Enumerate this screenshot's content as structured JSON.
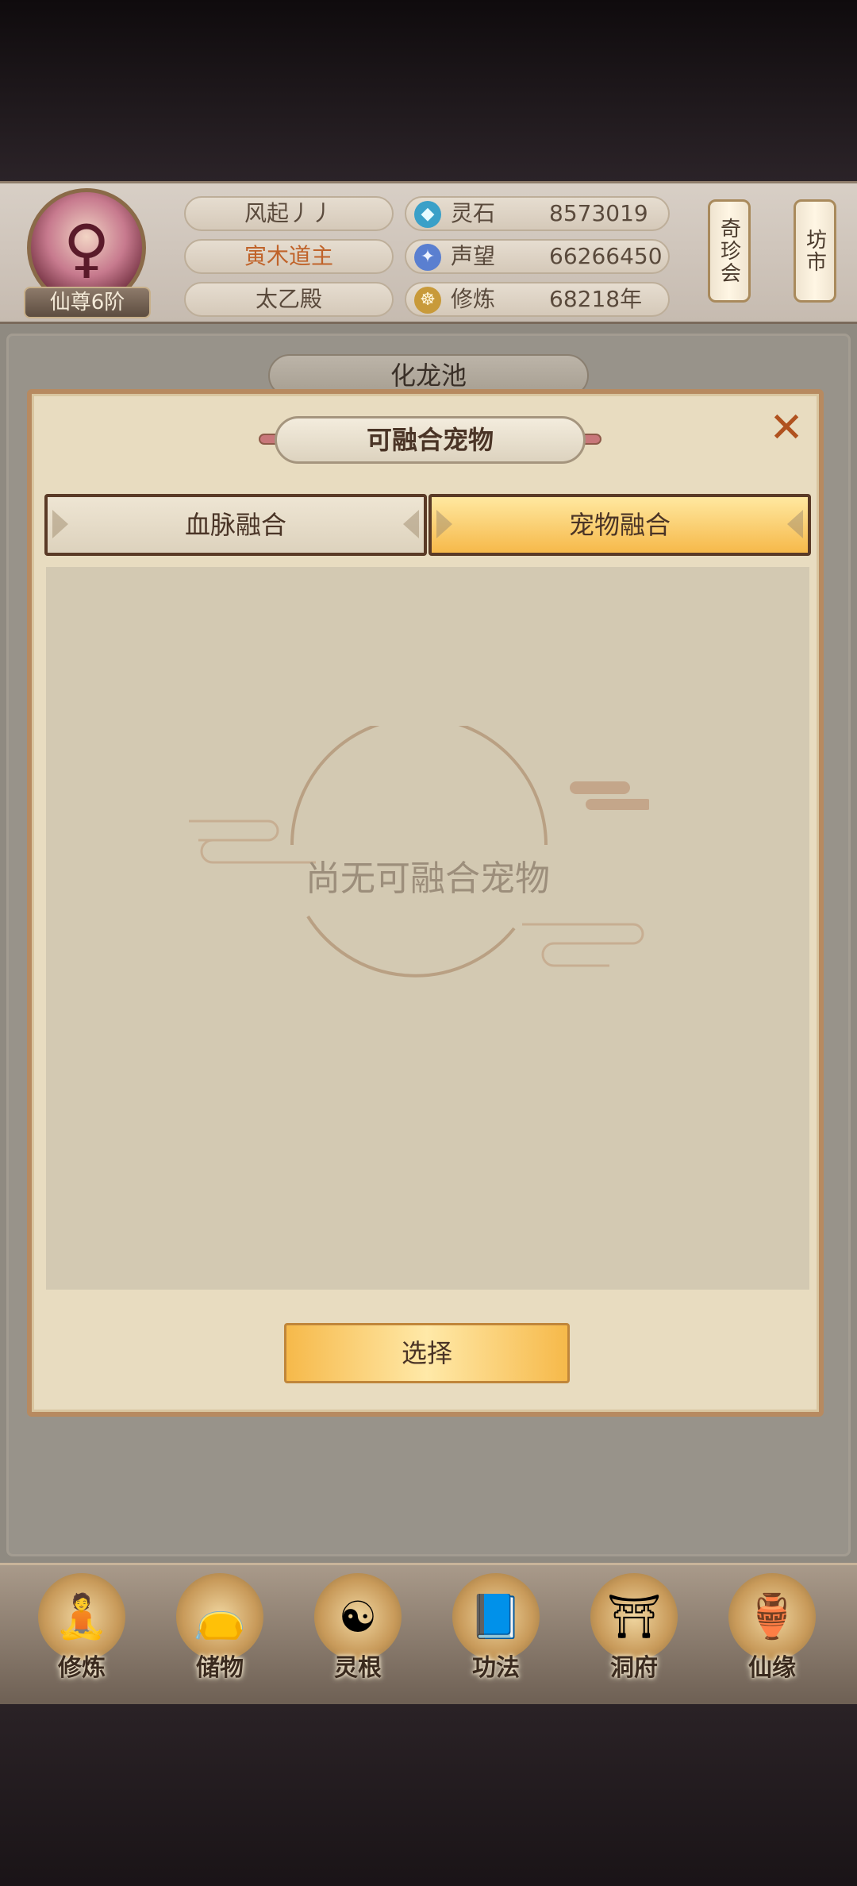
{
  "header": {
    "rank": "仙尊6阶",
    "name_line1": "风起丿丿",
    "name_line2": "寅木道主",
    "name_line3": "太乙殿",
    "resources": [
      {
        "icon": "spirit-stone-icon",
        "label": "灵石",
        "value": "8573019"
      },
      {
        "icon": "reputation-icon",
        "label": "声望",
        "value": "66266450"
      },
      {
        "icon": "cultivation-icon",
        "label": "修炼",
        "value": "68218年"
      }
    ],
    "right_buttons": [
      "奇珍会",
      "坊市"
    ]
  },
  "background_title": "化龙池",
  "dialog": {
    "title": "可融合宠物",
    "tabs": [
      {
        "label": "血脉融合",
        "active": false
      },
      {
        "label": "宠物融合",
        "active": true
      }
    ],
    "empty_text": "尚无可融合宠物",
    "select_button": "选择"
  },
  "bottom_nav": [
    {
      "icon": "cultivate-icon",
      "label": "修炼"
    },
    {
      "icon": "storage-bag-icon",
      "label": "储物"
    },
    {
      "icon": "spirit-root-icon",
      "label": "灵根"
    },
    {
      "icon": "technique-book-icon",
      "label": "功法"
    },
    {
      "icon": "cave-mansion-icon",
      "label": "洞府"
    },
    {
      "icon": "fate-gourd-icon",
      "label": "仙缘"
    }
  ],
  "colors": {
    "accent_gold": "#f6b94a",
    "rank_orange": "#c0632a",
    "dialog_bg": "#e8dcc0",
    "close_orange": "#b0521f"
  }
}
